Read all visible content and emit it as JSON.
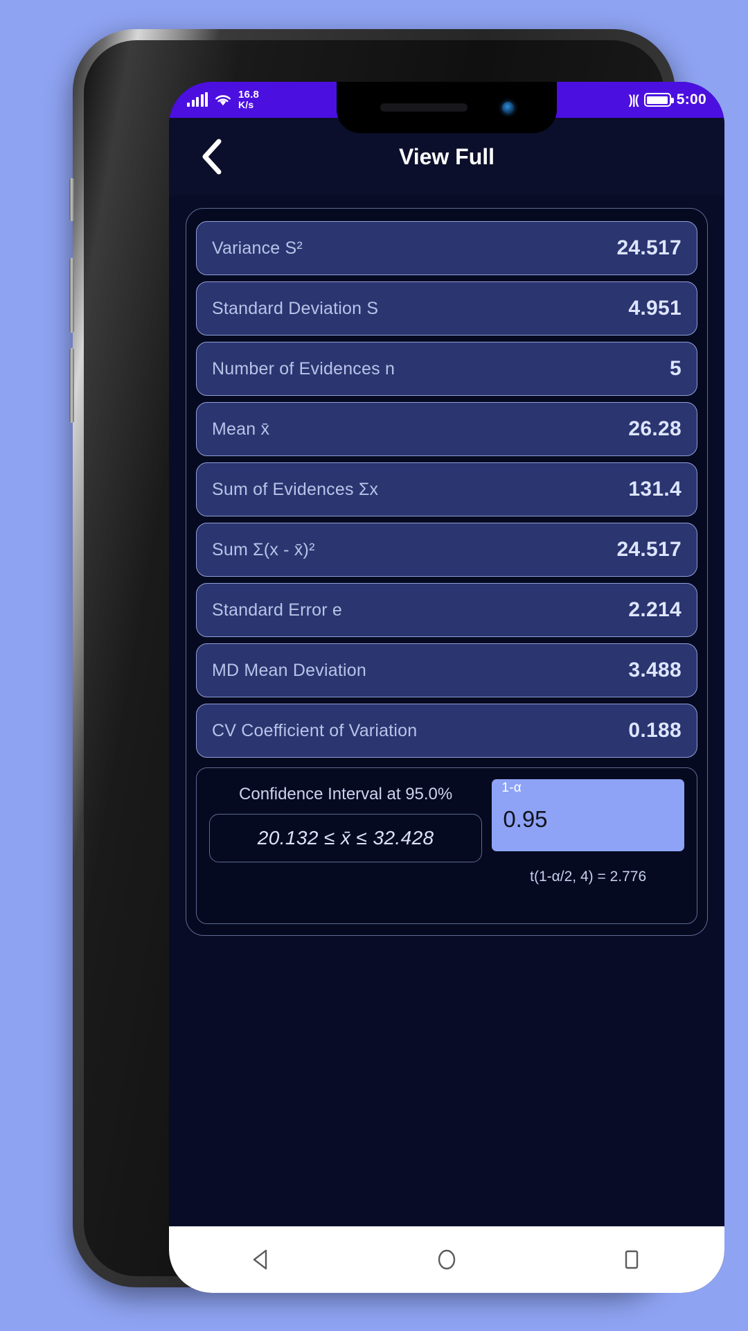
{
  "status_bar": {
    "signal_icon": "signal-bars-icon",
    "wifi_icon": "wifi-icon",
    "net_speed_value": "16.8",
    "net_speed_unit": "K/s",
    "vibrate_icon": "vibrate-icon",
    "battery_icon": "battery-icon",
    "time": "5:00",
    "background_color": "#4b10e0"
  },
  "appbar": {
    "back_icon": "chevron-left-icon",
    "title": "View Full"
  },
  "stats": {
    "rows": [
      {
        "label": "Variance S²",
        "value": "24.517"
      },
      {
        "label": "Standard Deviation S",
        "value": "4.951"
      },
      {
        "label": "Number of Evidences n",
        "value": "5"
      },
      {
        "label": "Mean x̄",
        "value": "26.28"
      },
      {
        "label": "Sum of Evidences Σx",
        "value": "131.4"
      },
      {
        "label": "Sum Σ(x - x̄)²",
        "value": "24.517"
      },
      {
        "label": "Standard Error e",
        "value": "2.214"
      },
      {
        "label": "MD Mean Deviation",
        "value": "3.488"
      },
      {
        "label": "CV Coefficient of Variation",
        "value": "0.188"
      }
    ]
  },
  "confidence": {
    "title": "Confidence Interval at 95.0%",
    "interval": "20.132 ≤ x̄ ≤ 32.428",
    "alpha_caption": "1-α",
    "alpha_value": "0.95",
    "t_note": "t(1-α/2, 4) =\n2.776",
    "alpha_field_color": "#8ea3f6"
  },
  "navbar": {
    "back_icon": "nav-back-triangle-icon",
    "home_icon": "nav-home-circle-icon",
    "recent_icon": "nav-recents-square-icon"
  },
  "theme": {
    "page_background": "#8ea3f2",
    "screen_background": "#080c26",
    "pill_fill": "#2b3570",
    "pill_border": "#8fa0d8",
    "label_color": "#b9c3e8",
    "value_color": "#dde5ff"
  }
}
